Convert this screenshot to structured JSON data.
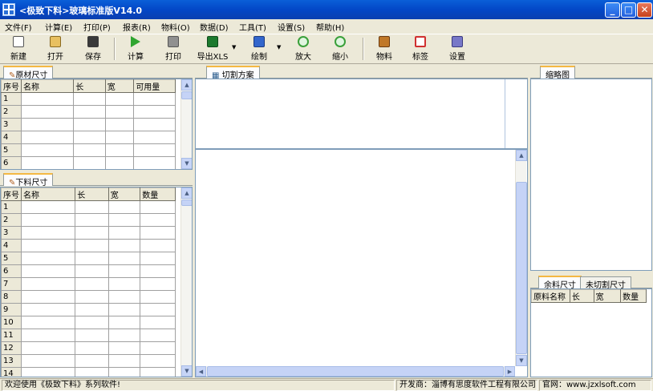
{
  "window": {
    "title": "<极致下料>玻璃标准版V14.0",
    "minimize": "_",
    "maximize": "□",
    "close": "✕"
  },
  "menu": [
    "文件(F)",
    "计算(E)",
    "打印(P)",
    "报表(R)",
    "物料(O)",
    "数据(D)",
    "工具(T)",
    "设置(S)",
    "帮助(H)"
  ],
  "toolbar": [
    {
      "label": "新建",
      "icon": "new-file-icon",
      "color": "#ffffff"
    },
    {
      "label": "打开",
      "icon": "open-folder-icon",
      "color": "#e8c060"
    },
    {
      "label": "保存",
      "icon": "save-disk-icon",
      "color": "#3a3a3a"
    },
    {
      "label": "计算",
      "icon": "play-calc-icon",
      "color": "#2fa52f"
    },
    {
      "label": "打印",
      "icon": "printer-icon",
      "color": "#808080"
    },
    {
      "label": "导出XLS",
      "icon": "excel-icon",
      "color": "#1d7a2e"
    },
    {
      "label": "绘制",
      "icon": "draw-icon",
      "color": "#3366cc"
    },
    {
      "label": "放大",
      "icon": "zoom-in-icon",
      "color": "#3aa03a"
    },
    {
      "label": "缩小",
      "icon": "zoom-out-icon",
      "color": "#3aa03a"
    },
    {
      "label": "物料",
      "icon": "material-icon",
      "color": "#c07828"
    },
    {
      "label": "标签",
      "icon": "label-icon",
      "color": "#d03030"
    },
    {
      "label": "设置",
      "icon": "settings-icon",
      "color": "#7878c8"
    }
  ],
  "raw_panel": {
    "tab": "原材尺寸",
    "headers": [
      "序号",
      "名称",
      "长",
      "宽",
      "可用量"
    ],
    "rows": [
      "1",
      "2",
      "3",
      "4",
      "5",
      "6"
    ]
  },
  "cut_panel": {
    "tab": "下料尺寸",
    "headers": [
      "序号",
      "名称",
      "长",
      "宽",
      "数量"
    ],
    "rows": [
      "1",
      "2",
      "3",
      "4",
      "5",
      "6",
      "7",
      "8",
      "9",
      "10",
      "11",
      "12",
      "13",
      "14"
    ]
  },
  "plan_panel": {
    "tab": "切割方案"
  },
  "thumb_panel": {
    "tab": "缩略图"
  },
  "rest_panel": {
    "tabs": [
      "余料尺寸",
      "未切割尺寸"
    ],
    "headers": [
      "原料名称",
      "长",
      "宽",
      "数量"
    ]
  },
  "status": {
    "welcome": "欢迎使用《极致下料》系列软件!",
    "developer": "开发商：淄博有思度软件工程有限公司",
    "website": "官网：www.jzxlsoft.com"
  }
}
